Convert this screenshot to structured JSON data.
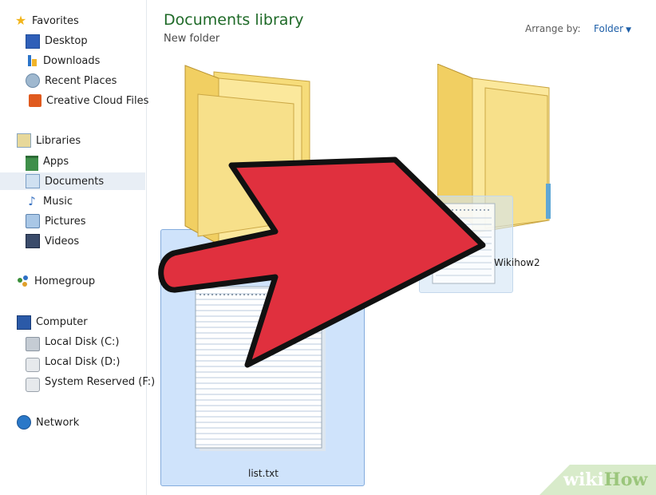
{
  "sidebar": {
    "favorites": {
      "header": "Favorites",
      "items": [
        {
          "label": "Desktop",
          "icon": "desktop-icon"
        },
        {
          "label": "Downloads",
          "icon": "downloads-icon"
        },
        {
          "label": "Recent Places",
          "icon": "recent-places-icon"
        },
        {
          "label": "Creative Cloud Files",
          "icon": "creative-cloud-icon"
        }
      ]
    },
    "libraries": {
      "header": "Libraries",
      "items": [
        {
          "label": "Apps",
          "icon": "apps-icon"
        },
        {
          "label": "Documents",
          "icon": "documents-icon",
          "selected": true
        },
        {
          "label": "Music",
          "icon": "music-icon"
        },
        {
          "label": "Pictures",
          "icon": "pictures-icon"
        },
        {
          "label": "Videos",
          "icon": "videos-icon"
        }
      ]
    },
    "homegroup": {
      "label": "Homegroup",
      "icon": "homegroup-icon"
    },
    "computer": {
      "header": "Computer",
      "items": [
        {
          "label": "Local Disk (C:)",
          "icon": "local-disk-icon"
        },
        {
          "label": "Local Disk (D:)",
          "icon": "local-disk-icon"
        },
        {
          "label": "System Reserved (F:)",
          "icon": "local-disk-icon"
        }
      ]
    },
    "network": {
      "label": "Network",
      "icon": "network-icon"
    }
  },
  "library": {
    "title": "Documents library",
    "subtitle": "New folder",
    "arrange_by_label": "Arrange by:",
    "arrange_by_value": "Folder"
  },
  "items": [
    {
      "type": "folder",
      "name": ""
    },
    {
      "type": "folder",
      "name": "Wikihow2"
    },
    {
      "type": "text-file",
      "name": "list.txt",
      "selected": true
    }
  ],
  "overlay": {
    "arrow_color": "#e0303e",
    "arrow_direction": "right"
  },
  "watermark": {
    "part1": "wiki",
    "part2": "How"
  },
  "colors": {
    "title_green": "#1f6a28",
    "link_blue": "#1e5fa8",
    "selection": "#cfe3fb"
  }
}
